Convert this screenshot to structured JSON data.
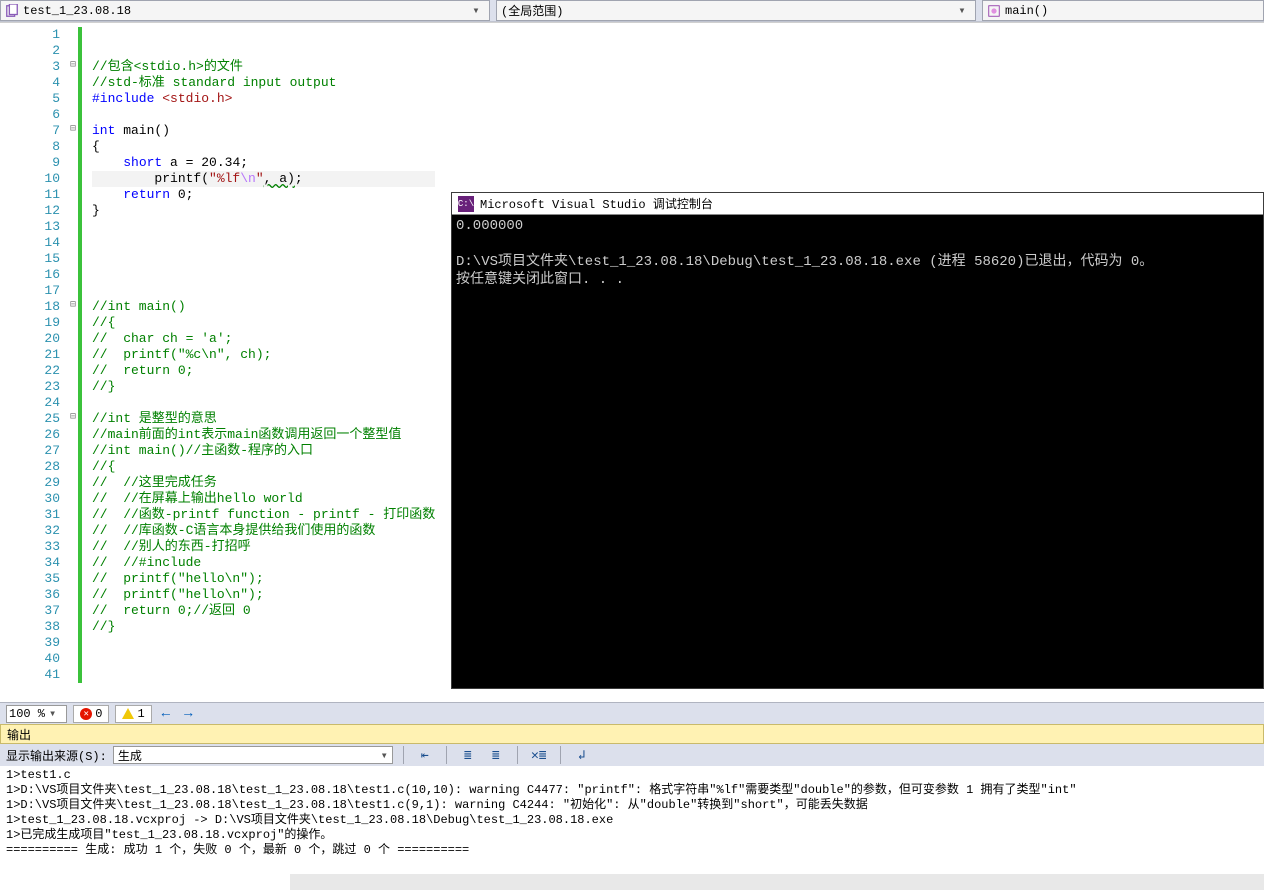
{
  "topbar": {
    "file": "test_1_23.08.18",
    "scope": "(全局范围)",
    "func": "main()"
  },
  "code": [
    "",
    "",
    "//包含<stdio.h>的文件",
    "//std-标准 standard input output",
    "#include <stdio.h>",
    "",
    "int main()",
    "{",
    "    short a = 20.34;",
    "        printf(\"%lf\\n\", a);",
    "    return 0;",
    "}",
    "",
    "",
    "",
    "",
    "",
    "//int main()",
    "//{",
    "//  char ch = 'a';",
    "//  printf(\"%c\\n\", ch);",
    "//  return 0;",
    "//}",
    "",
    "//int 是整型的意思",
    "//main前面的int表示main函数调用返回一个整型值",
    "//int main()//主函数-程序的入口",
    "//{",
    "//  //这里完成任务",
    "//  //在屏幕上输出hello world",
    "//  //函数-printf function - printf - 打印函数",
    "//  //库函数-C语言本身提供给我们使用的函数",
    "//  //别人的东西-打招呼",
    "//  //#include",
    "//  printf(\"hello\\n\");",
    "//  printf(\"hello\\n\");",
    "//  return 0;//返回 0",
    "//}",
    "",
    "",
    ""
  ],
  "console": {
    "title": "Microsoft Visual Studio 调试控制台",
    "lines": [
      "0.000000",
      "",
      "D:\\VS项目文件夹\\test_1_23.08.18\\Debug\\test_1_23.08.18.exe (进程 58620)已退出，代码为 0。",
      "按任意键关闭此窗口. . ."
    ]
  },
  "status": {
    "zoom": "100 %",
    "errors": "0",
    "warnings": "1"
  },
  "output": {
    "panel_title": "输出",
    "source_label": "显示输出来源(S):",
    "source_value": "生成",
    "lines": [
      "1>test1.c",
      "1>D:\\VS项目文件夹\\test_1_23.08.18\\test_1_23.08.18\\test1.c(10,10): warning C4477: \"printf\": 格式字符串\"%lf\"需要类型\"double\"的参数，但可变参数 1 拥有了类型\"int\"",
      "1>D:\\VS项目文件夹\\test_1_23.08.18\\test_1_23.08.18\\test1.c(9,1): warning C4244: \"初始化\": 从\"double\"转换到\"short\"，可能丢失数据",
      "1>test_1_23.08.18.vcxproj -> D:\\VS项目文件夹\\test_1_23.08.18\\Debug\\test_1_23.08.18.exe",
      "1>已完成生成项目\"test_1_23.08.18.vcxproj\"的操作。",
      "========== 生成: 成功 1 个，失败 0 个，最新 0 个，跳过 0 个 =========="
    ]
  }
}
